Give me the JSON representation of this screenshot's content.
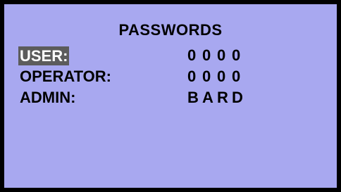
{
  "screen": {
    "title": "PASSWORDS",
    "background_color": "#a8a8f0",
    "border_color": "#000000",
    "highlight_color": "#5c5c5c",
    "rows": [
      {
        "label": "USER:",
        "value": [
          "0",
          "0",
          "0",
          "0"
        ],
        "selected": true
      },
      {
        "label": "OPERATOR:",
        "value": [
          "0",
          "0",
          "0",
          "0"
        ],
        "selected": false
      },
      {
        "label": "ADMIN:",
        "value": [
          "B",
          "A",
          "R",
          "D"
        ],
        "selected": false
      }
    ]
  }
}
